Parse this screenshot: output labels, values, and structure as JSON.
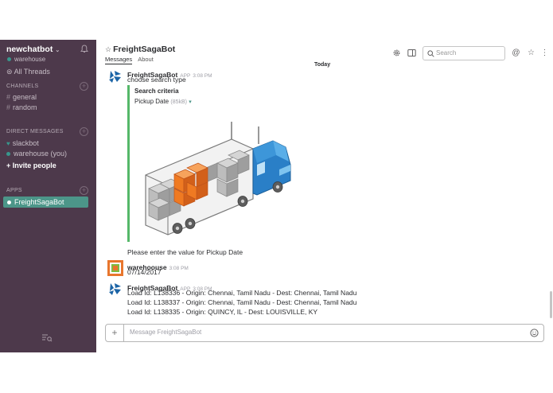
{
  "sidebar": {
    "team_name": "newchatbot",
    "team_caret": "⌄",
    "user": "warehouse",
    "all_threads": "All Threads",
    "channels_header": "CHANNELS",
    "channels": [
      "general",
      "random"
    ],
    "dm_header": "DIRECT MESSAGES",
    "dms": [
      "slackbot",
      "warehouse (you)"
    ],
    "invite": "+ Invite people",
    "apps_header": "APPS",
    "apps": [
      "FreightSagaBot"
    ],
    "accent": "#4c9689"
  },
  "header": {
    "channel_name": "FreightSagaBot",
    "tabs": [
      "Messages",
      "About"
    ],
    "search_placeholder": "Search"
  },
  "divider_label": "Today",
  "messages": [
    {
      "author": "FreightSagaBot",
      "badge": "APP",
      "time": "3:08 PM",
      "text": "choose search type",
      "attachment": {
        "title": "Search criteria",
        "file_name": "Pickup Date",
        "file_size": "(85kB)",
        "caret": "▾"
      },
      "followup": "Please enter the value for Pickup Date"
    },
    {
      "author": "warehoouse",
      "time": "3:08 PM",
      "text": "07/14/2017"
    },
    {
      "author": "FreightSagaBot",
      "badge": "APP",
      "time": "3:08 PM",
      "lines": [
        "Load Id: L138336 - Origin: Chennai, Tamil Nadu - Dest: Chennai, Tamil Nadu",
        "Load Id: L138337 - Origin: Chennai, Tamil Nadu - Dest: Chennai, Tamil Nadu",
        "Load Id: L138335 - Origin: QUINCY, IL - Dest: LOUISVILLE, KY"
      ]
    }
  ],
  "composer": {
    "plus": "+",
    "placeholder": "Message FreightSagaBot"
  }
}
